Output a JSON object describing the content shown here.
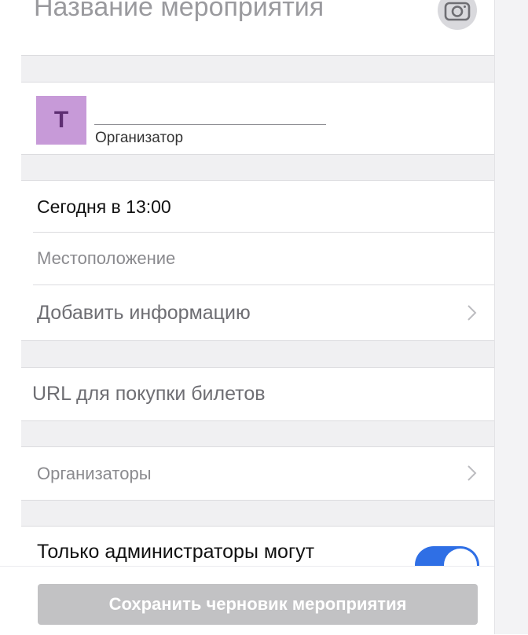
{
  "header": {
    "title_placeholder": "Название мероприятия",
    "camera_icon": "camera-icon"
  },
  "organizer": {
    "avatar_letter": "T",
    "avatar_color": "#c79ad8",
    "label": "Организатор"
  },
  "details": {
    "date": "Сегодня в 13:00",
    "location_placeholder": "Местоположение",
    "add_info": "Добавить информацию"
  },
  "tickets": {
    "url_placeholder": "URL для покупки билетов"
  },
  "organizers": {
    "label": "Организаторы"
  },
  "permissions": {
    "admins_only_label": "Только администраторы могут",
    "toggle_on": true,
    "toggle_color": "#2f6fe5"
  },
  "footer": {
    "save_draft": "Сохранить черновик мероприятия"
  }
}
